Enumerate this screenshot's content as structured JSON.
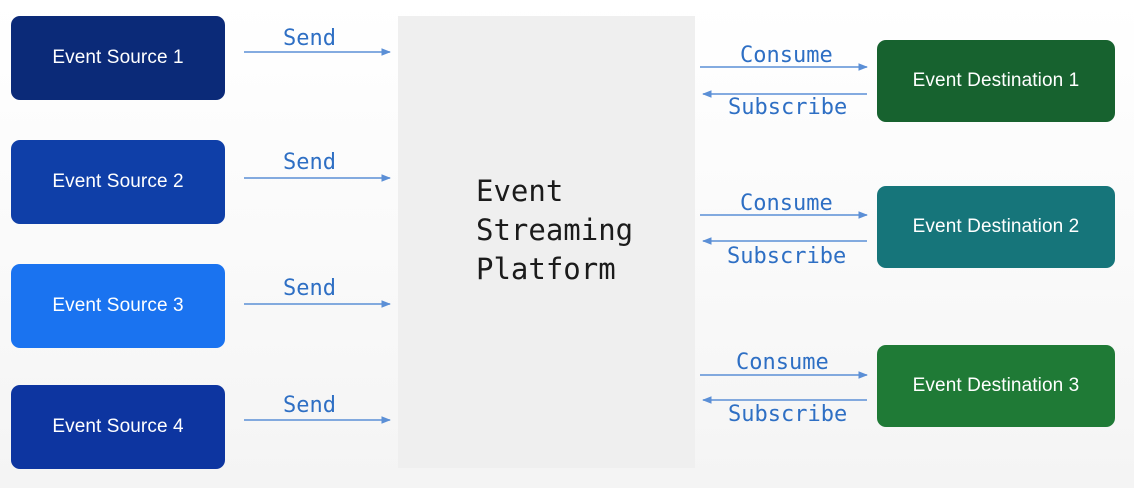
{
  "platform": {
    "lines": [
      "Event",
      "Streaming",
      "Platform"
    ]
  },
  "sources": [
    {
      "label": "Event Source 1",
      "color": "#0b2a78",
      "action": "Send"
    },
    {
      "label": "Event Source 2",
      "color": "#0f3fa8",
      "action": "Send"
    },
    {
      "label": "Event Source 3",
      "color": "#1a73f0",
      "action": "Send"
    },
    {
      "label": "Event Source 4",
      "color": "#0d35a0",
      "action": "Send"
    }
  ],
  "destinations": [
    {
      "label": "Event Destination 1",
      "color": "#17622f",
      "consume": "Consume",
      "subscribe": "Subscribe"
    },
    {
      "label": "Event Destination 2",
      "color": "#16757a",
      "consume": "Consume",
      "subscribe": "Subscribe"
    },
    {
      "label": "Event Destination 3",
      "color": "#1f7a36",
      "consume": "Consume",
      "subscribe": "Subscribe"
    }
  ],
  "colors": {
    "arrow": "#5b8fd6",
    "label": "#2e6fc4"
  }
}
